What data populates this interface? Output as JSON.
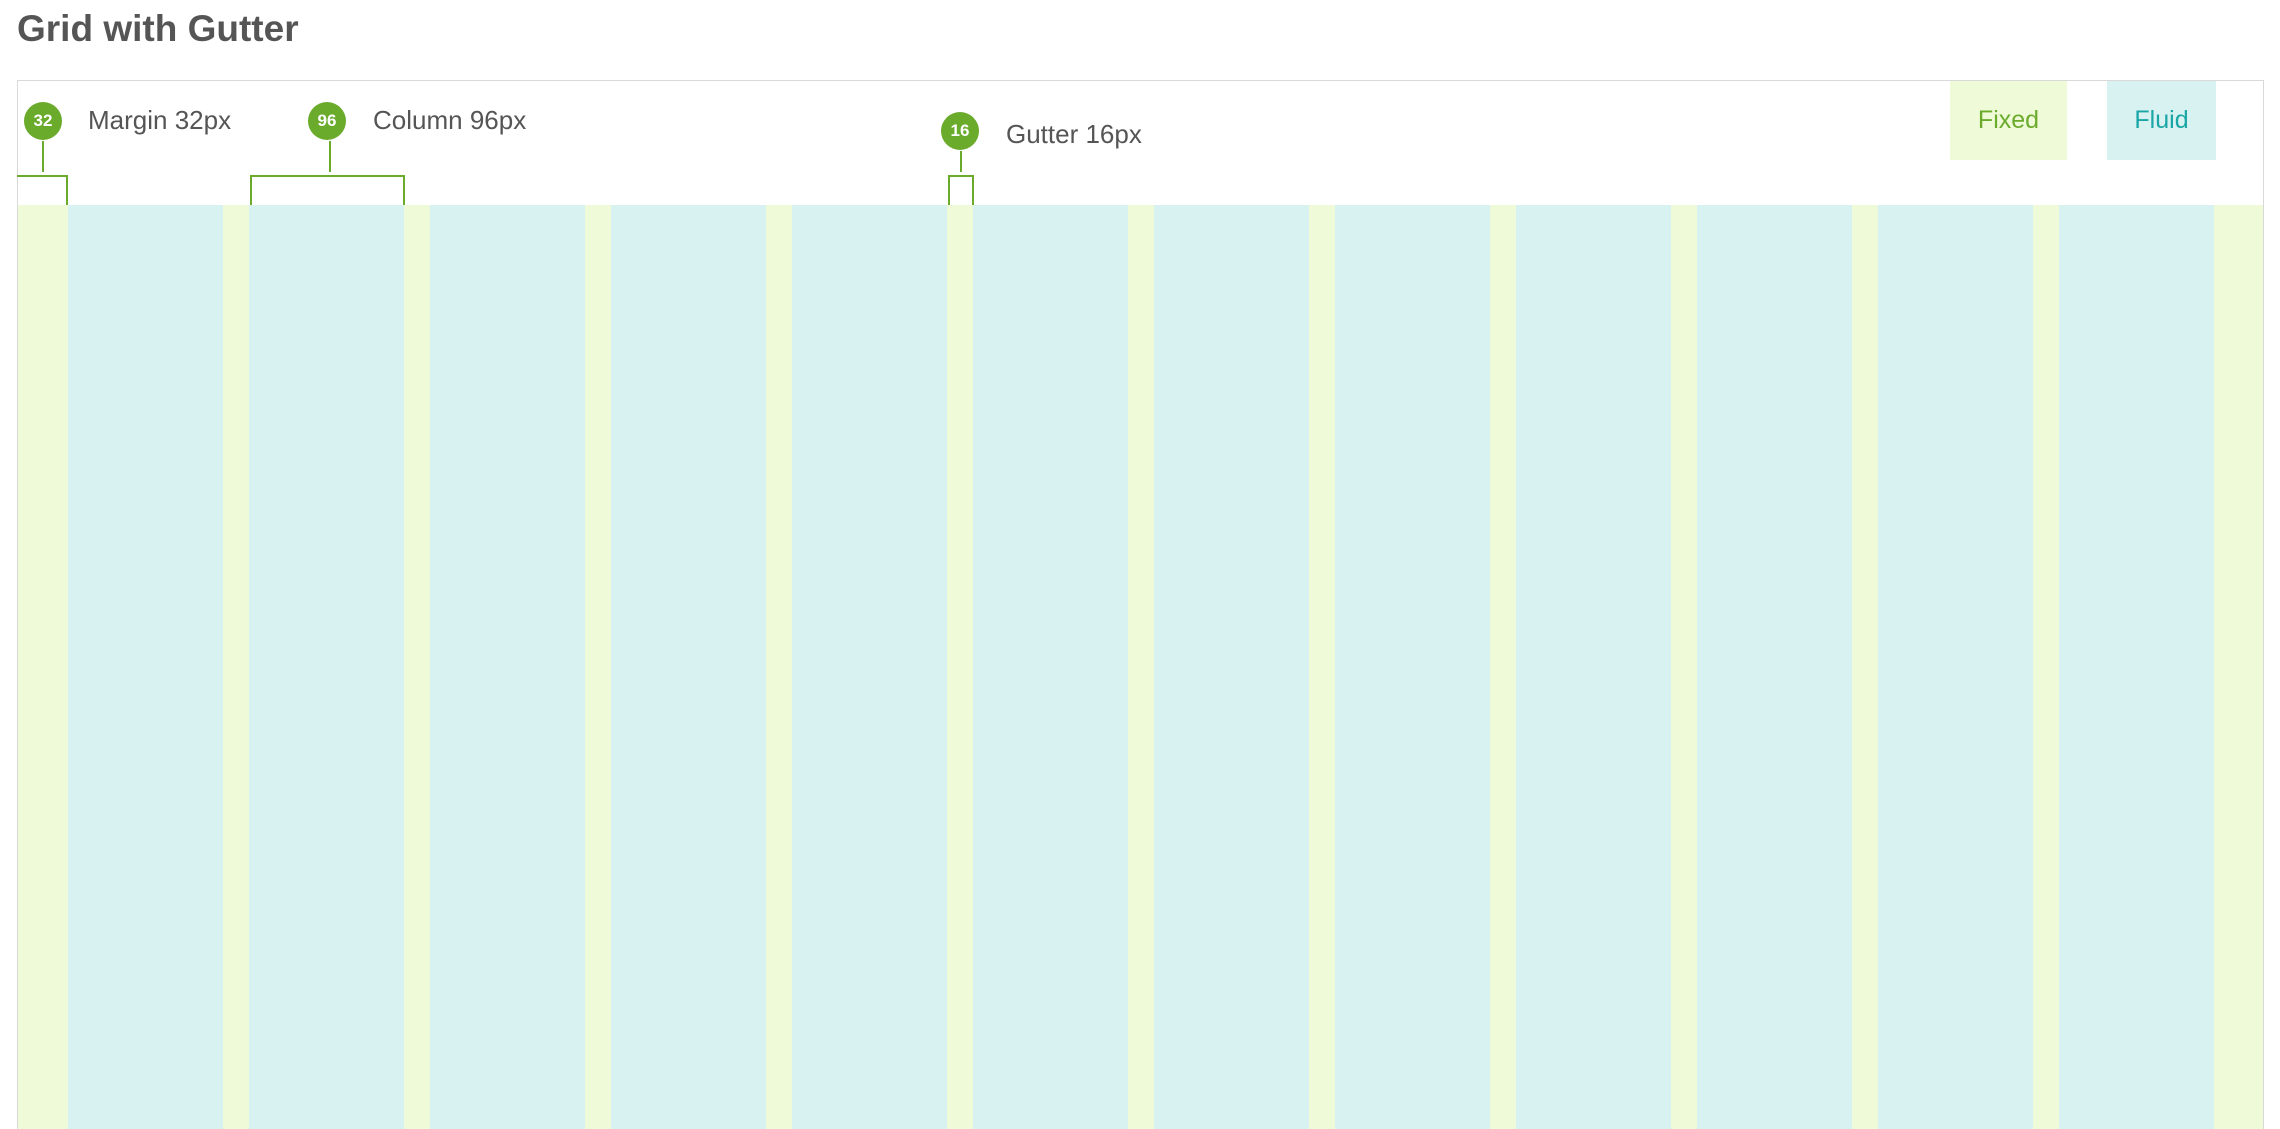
{
  "title": "Grid with Gutter",
  "annotations": {
    "margin": {
      "badge": "32",
      "label": "Margin 32px"
    },
    "column": {
      "badge": "96",
      "label": "Column 96px"
    },
    "gutter": {
      "badge": "16",
      "label": "Gutter 16px"
    }
  },
  "legend": {
    "fixed": {
      "label": "Fixed",
      "color": "#effbd8",
      "text_color": "#6aab2c"
    },
    "fluid": {
      "label": "Fluid",
      "color": "#d8f1f1",
      "text_color": "#1aa6a6"
    }
  },
  "grid": {
    "column_count": 12,
    "margin_color": "#effbd8",
    "gutter_color": "#effbd8",
    "column_color": "#d8f1f1",
    "accent_color": "#6aab2c"
  }
}
